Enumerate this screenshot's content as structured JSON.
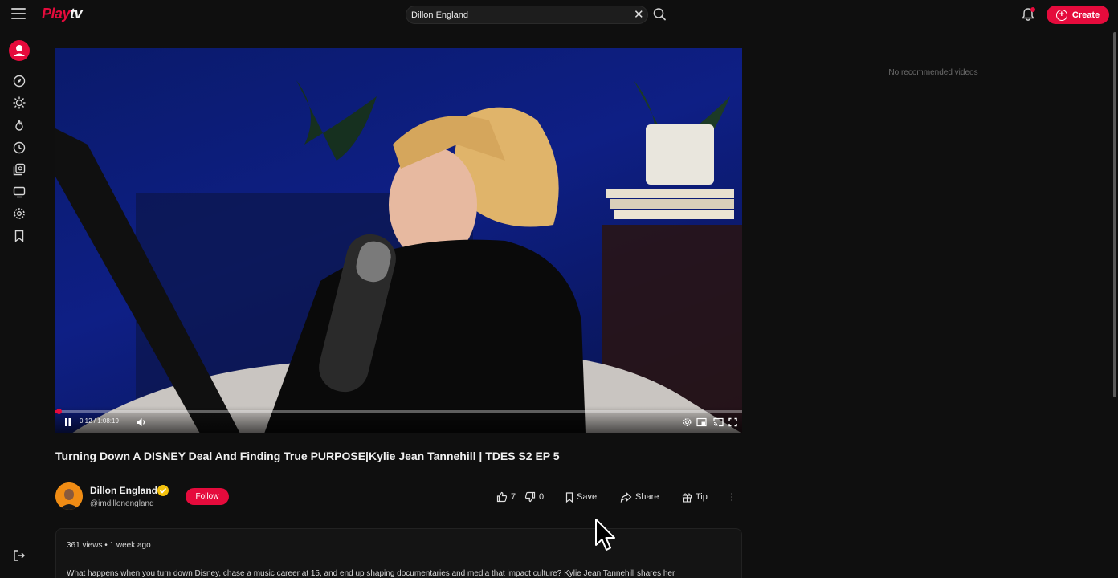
{
  "app": {
    "logo_part1": "Play",
    "logo_part2": "tv",
    "brand_color": "#e50b3c"
  },
  "search": {
    "value": "Dillon England",
    "placeholder": "Search"
  },
  "topbar": {
    "create_label": "Create"
  },
  "sidebar": {
    "items": [
      {
        "icon": "compass-icon"
      },
      {
        "icon": "sun-icon"
      },
      {
        "icon": "flame-icon"
      },
      {
        "icon": "clock-icon"
      },
      {
        "icon": "library-icon"
      },
      {
        "icon": "tv-icon"
      },
      {
        "icon": "settings-icon"
      },
      {
        "icon": "bookmark-icon"
      }
    ],
    "bottom_icon": "logout-icon"
  },
  "player": {
    "current_time": "0:12",
    "duration": "1:08:19",
    "time_display": "0:12 / 1:08:19",
    "progress_fraction": 0.003
  },
  "video": {
    "title": "Turning Down A DISNEY Deal And Finding True PURPOSE|Kylie Jean Tannehill | TDES S2 EP 5"
  },
  "channel": {
    "name": "Dillon England",
    "handle": "@imdillonengland",
    "follow_label": "Follow"
  },
  "actions": {
    "likes": "7",
    "dislikes": "0",
    "save_label": "Save",
    "share_label": "Share",
    "tip_label": "Tip"
  },
  "description": {
    "meta": "361 views • 1 week ago",
    "text": "What happens when you turn down Disney, chase a music career at 15, and end up shaping documentaries and media that impact culture? Kylie Jean Tannehill shares her"
  },
  "recommendations": {
    "empty_text": "No recommended videos"
  }
}
